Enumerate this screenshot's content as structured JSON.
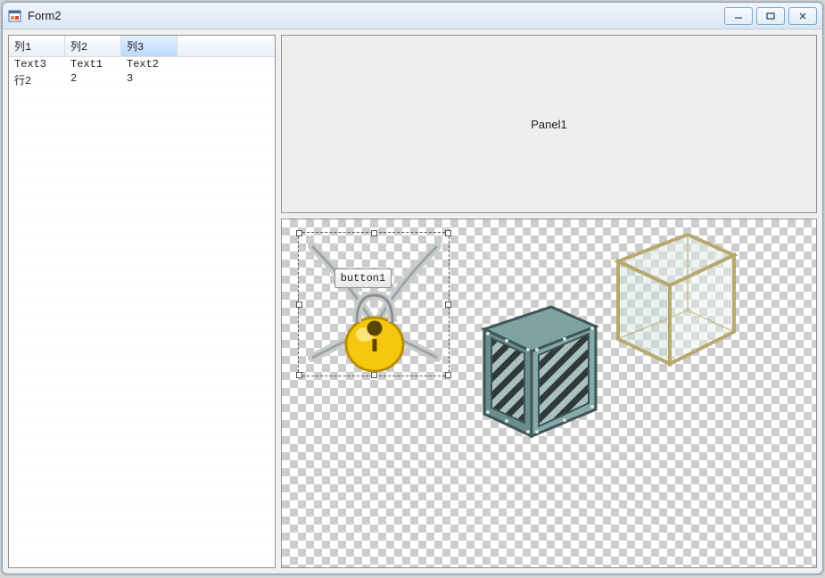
{
  "window": {
    "title": "Form2"
  },
  "listview": {
    "columns": [
      "列1",
      "列2",
      "列3"
    ],
    "selected_column_index": 2,
    "rows": [
      {
        "c0": "Text3",
        "c1": "Text1",
        "c2": "Text2"
      },
      {
        "c0": "行2",
        "c1": "2",
        "c2": "3"
      }
    ]
  },
  "panel": {
    "label": "Panel1"
  },
  "design": {
    "button_label": "button1",
    "assets": {
      "padlock": "padlock-and-chains",
      "metalbox": "riveted-metal-crate",
      "glassbox": "glass-cube"
    }
  }
}
